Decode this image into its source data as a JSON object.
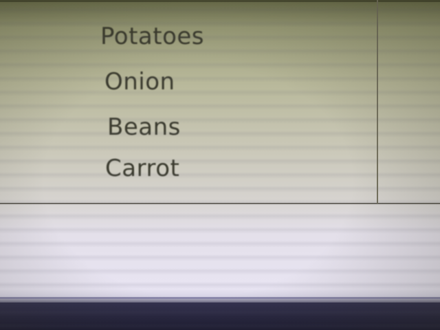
{
  "list": {
    "items": [
      {
        "label": "Potatoes"
      },
      {
        "label": "Onion"
      },
      {
        "label": "Beans"
      },
      {
        "label": "Carrot"
      }
    ]
  },
  "colors": {
    "text": "#3a3a2e",
    "table_background": "#b8b89a",
    "divider": "#75725f",
    "lower_area": "#e4e0ea",
    "bezel": "#1d1c33"
  }
}
